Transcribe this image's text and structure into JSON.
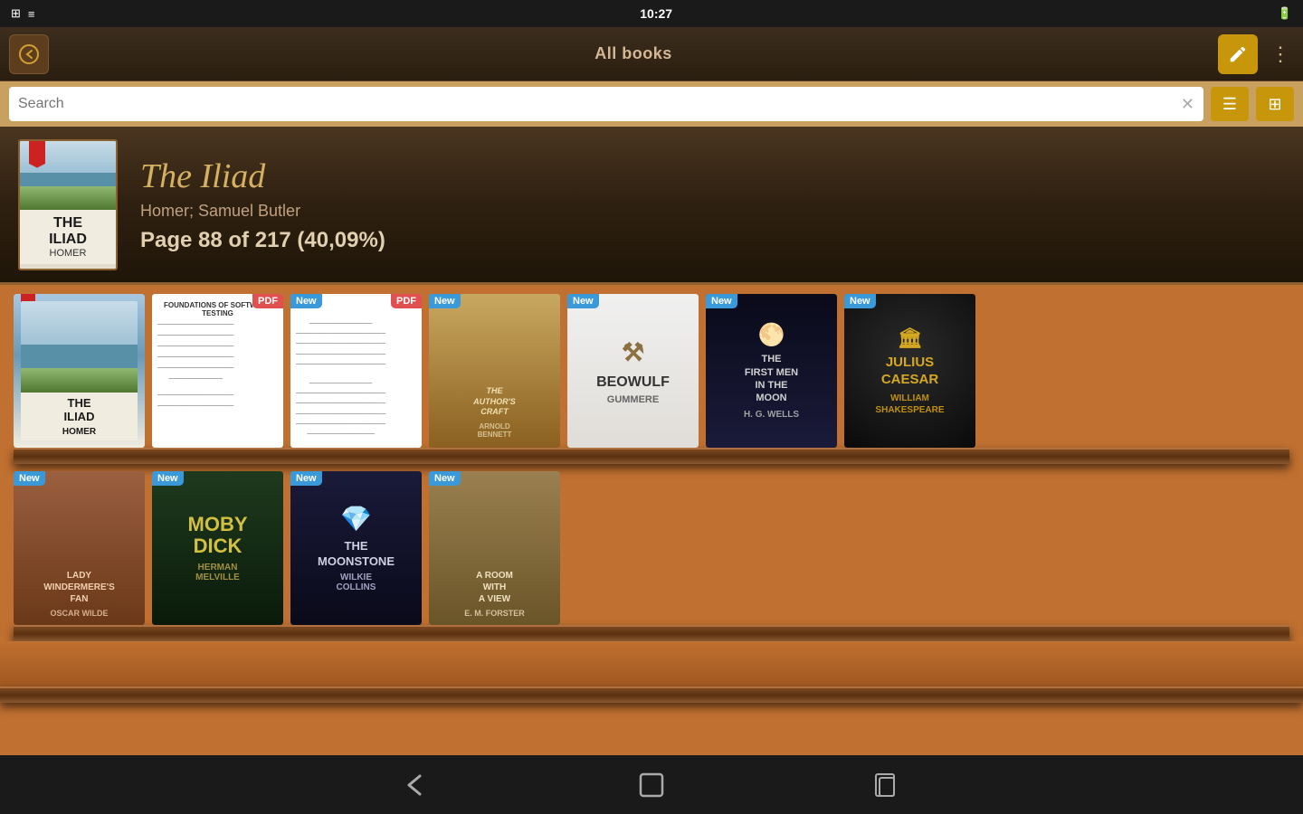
{
  "status_bar": {
    "time": "10:27",
    "icons_left": [
      "grid-icon",
      "bars-icon"
    ],
    "icons_right": [
      "battery-icon"
    ]
  },
  "top_bar": {
    "title": "All books",
    "back_label": "←",
    "edit_label": "✎",
    "more_label": "⋮"
  },
  "search": {
    "placeholder": "Search",
    "clear_label": "✕"
  },
  "view_modes": {
    "list_label": "☰",
    "grid_label": "⊞"
  },
  "featured": {
    "title": "The Iliad",
    "author": "Homer; Samuel Butler",
    "progress": "Page 88 of 217 (40,09%)"
  },
  "shelf1": {
    "books": [
      {
        "id": "iliad",
        "badge": "",
        "title": "THE ILIAD",
        "author": "HOMER",
        "cover_type": "iliad"
      },
      {
        "id": "foundations",
        "badge": "PDF",
        "title": "FOUNDATIONS OF SOFTWARE TESTING",
        "author": "",
        "cover_type": "foundations"
      },
      {
        "id": "unknown-pdf",
        "badge_new": "New",
        "badge_pdf": "PDF",
        "title": "",
        "author": "",
        "cover_type": "unknown"
      },
      {
        "id": "authors-craft",
        "badge_new": "New",
        "title": "THE AUTHOR'S CRAFT",
        "author": "ARNOLD BENNETT",
        "cover_type": "authors-craft"
      },
      {
        "id": "beowulf",
        "badge_new": "New",
        "title": "BEOWULF",
        "author": "GUMMERE",
        "cover_type": "beowulf"
      },
      {
        "id": "first-men",
        "badge_new": "New",
        "title": "THE FIRST MEN IN THE MOON",
        "author": "H. G. WELLS",
        "cover_type": "first-men"
      },
      {
        "id": "julius-caesar",
        "badge_new": "New",
        "title": "JULIUS CAESAR",
        "author": "WILLIAM SHAKESPEARE",
        "cover_type": "julius"
      }
    ]
  },
  "shelf2": {
    "books": [
      {
        "id": "lady-windermere",
        "badge_new": "New",
        "title": "LADY WINDERMERE'S FAN",
        "author": "OSCAR WILDE",
        "cover_type": "lady"
      },
      {
        "id": "moby-dick",
        "badge_new": "New",
        "title": "MOBY DICK",
        "author": "HERMAN MELVILLE",
        "cover_type": "moby"
      },
      {
        "id": "moonstone",
        "badge_new": "New",
        "title": "THE MOONSTONE",
        "author": "WILKIE COLLINS",
        "cover_type": "moonstone"
      },
      {
        "id": "room-with-view",
        "badge_new": "New",
        "title": "A ROOM WITH A VIEW",
        "author": "E. M. FORSTER",
        "cover_type": "room"
      }
    ]
  },
  "nav_bar": {
    "back_label": "←",
    "home_label": "⌂",
    "recents_label": "⧉"
  }
}
